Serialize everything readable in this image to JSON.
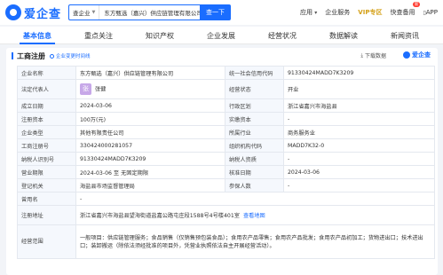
{
  "header": {
    "logo_text": "爱企查",
    "search_scope": "查企业",
    "search_query": "东方甄选（嘉兴）供应链管理有限公司",
    "search_button": "查一下",
    "nav": {
      "app": "应用",
      "service": "企业服务",
      "vip": "VIP专区",
      "tech": "快查备用",
      "tech_badge": "新",
      "app_download": "APP"
    }
  },
  "tabs": [
    {
      "label": "基本信息",
      "active": true
    },
    {
      "label": "重点关注",
      "active": false
    },
    {
      "label": "知识产权",
      "active": false
    },
    {
      "label": "企业发展",
      "active": false
    },
    {
      "label": "经营状况",
      "active": false
    },
    {
      "label": "数据解读",
      "active": false
    },
    {
      "label": "新闻资讯",
      "active": false
    }
  ],
  "card": {
    "title": "工商注册",
    "history_tag": "企业变更时间线",
    "download": "下载数据",
    "brand": "爱企查"
  },
  "info": {
    "company_name_label": "企业名称",
    "company_name": "东方甄选（嘉兴）供应链管理有限公司",
    "credit_code_label": "统一社会信用代码",
    "credit_code": "91330424MADD7K3209",
    "legal_rep_label": "法定代表人",
    "legal_rep_avatar": "张",
    "legal_rep": "张健",
    "status_label": "经营状态",
    "status": "开业",
    "est_date_label": "成立日期",
    "est_date": "2024-03-06",
    "authority_label": "行政区划",
    "authority": "浙江省嘉兴市海盐县",
    "reg_capital_label": "注册资本",
    "reg_capital": "100万(元)",
    "paid_capital_label": "实缴资本",
    "paid_capital": "-",
    "company_type_label": "企业类型",
    "company_type": "其他有限责任公司",
    "industry_label": "所属行业",
    "industry": "商务服务业",
    "reg_no_label": "工商注册号",
    "reg_no": "330424000281057",
    "org_code_label": "组织机构代码",
    "org_code": "MADD7K32-0",
    "taxpayer_id_label": "纳税人识别号",
    "taxpayer_id": "91330424MADD7K3209",
    "taxpayer_qual_label": "纳税人资质",
    "taxpayer_qual": "-",
    "term_label": "营业期限",
    "term": "2024-03-06 至 无固定期限",
    "approve_date_label": "核准日期",
    "approve_date": "2024-03-06",
    "reg_authority_label": "登记机关",
    "reg_authority": "海盐县市场监督管理局",
    "insured_label": "参保人数",
    "insured": "-",
    "former_name_label": "曾用名",
    "former_name": "-",
    "address_label": "注册地址",
    "address": "浙江省嘉兴市海盐县望海街道盐嘉公路屯庄段1588号4号楼401室",
    "address_link": "查看地图",
    "scope_label": "经营范围",
    "scope": "一般项目：供应链管理服务；食品销售（仅销售预包装食品）；食用农产品零售；食用农产品批发；食用农产品初加工；货物进出口；技术进出口；装卸搬运（除依法须经批准的项目外，凭营业执照依法自主开展经营活动）。"
  }
}
